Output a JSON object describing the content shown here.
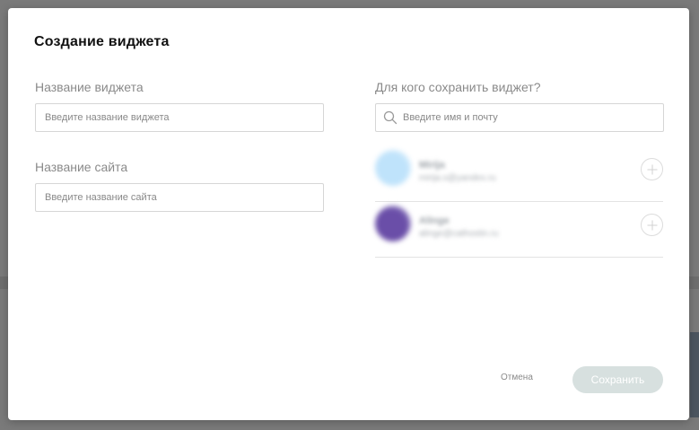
{
  "modal": {
    "title": "Создание виджета"
  },
  "widget_name": {
    "label": "Название виджета",
    "placeholder": "Введите название виджета",
    "value": ""
  },
  "site_name": {
    "label": "Название сайта",
    "placeholder": "Введите название сайта",
    "value": ""
  },
  "share": {
    "label": "Для кого сохранить виджет?",
    "search_placeholder": "Введите имя и почту",
    "users": [
      {
        "name": "Mirija",
        "email": "mirija.s@yandex.ru",
        "avatar_color": "#bfe3fb"
      },
      {
        "name": "Alinge",
        "email": "alinge@cathostin.ru",
        "avatar_color": "#6a4ea8"
      }
    ]
  },
  "actions": {
    "cancel_label": "Отмена",
    "save_label": "Сохранить"
  },
  "colors": {
    "save_button_bg": "#d7e0df",
    "overlay": "#7a7a7a"
  }
}
